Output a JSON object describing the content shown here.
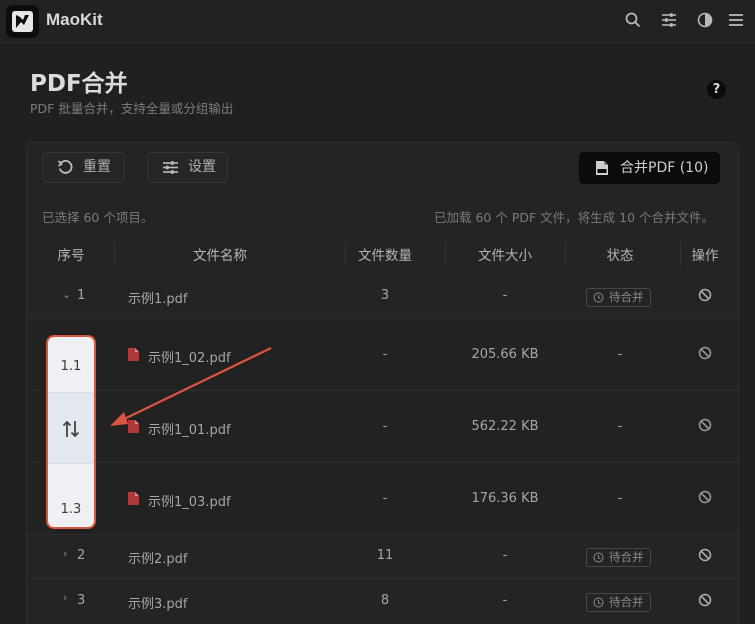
{
  "app": {
    "title": "MaoKit"
  },
  "page": {
    "title": "PDF合并",
    "subtitle": "PDF 批量合并，支持全量或分组输出",
    "help": "?"
  },
  "toolbar": {
    "reset_label": "重置",
    "settings_label": "设置",
    "merge_label": "合并PDF (10)"
  },
  "info": {
    "selected": "已选择 60 个项目。",
    "summary": "已加载 60 个 PDF 文件，将生成 10 个合并文件。"
  },
  "table": {
    "columns": [
      "序号",
      "文件名称",
      "文件数量",
      "文件大小",
      "状态",
      "操作"
    ],
    "groups": [
      {
        "index": "1",
        "name": "示例1.pdf",
        "count": "3",
        "size": "-",
        "status": "待合并",
        "expanded": true
      },
      {
        "index": "2",
        "name": "示例2.pdf",
        "count": "11",
        "size": "-",
        "status": "待合并",
        "expanded": false
      },
      {
        "index": "3",
        "name": "示例3.pdf",
        "count": "8",
        "size": "-",
        "status": "待合并",
        "expanded": false
      }
    ],
    "children": [
      {
        "index": "1.1",
        "name": "示例1_02.pdf",
        "count": "-",
        "size": "205.66 KB",
        "status": "-"
      },
      {
        "index": "↑↓",
        "name": "示例1_01.pdf",
        "count": "-",
        "size": "562.22 KB",
        "status": "-"
      },
      {
        "index": "1.3",
        "name": "示例1_03.pdf",
        "count": "-",
        "size": "176.36 KB",
        "status": "-"
      }
    ]
  },
  "colors": {
    "accent_annotation": "#d9553f",
    "pdf_icon": "#b03a3a",
    "background": "#202020"
  }
}
